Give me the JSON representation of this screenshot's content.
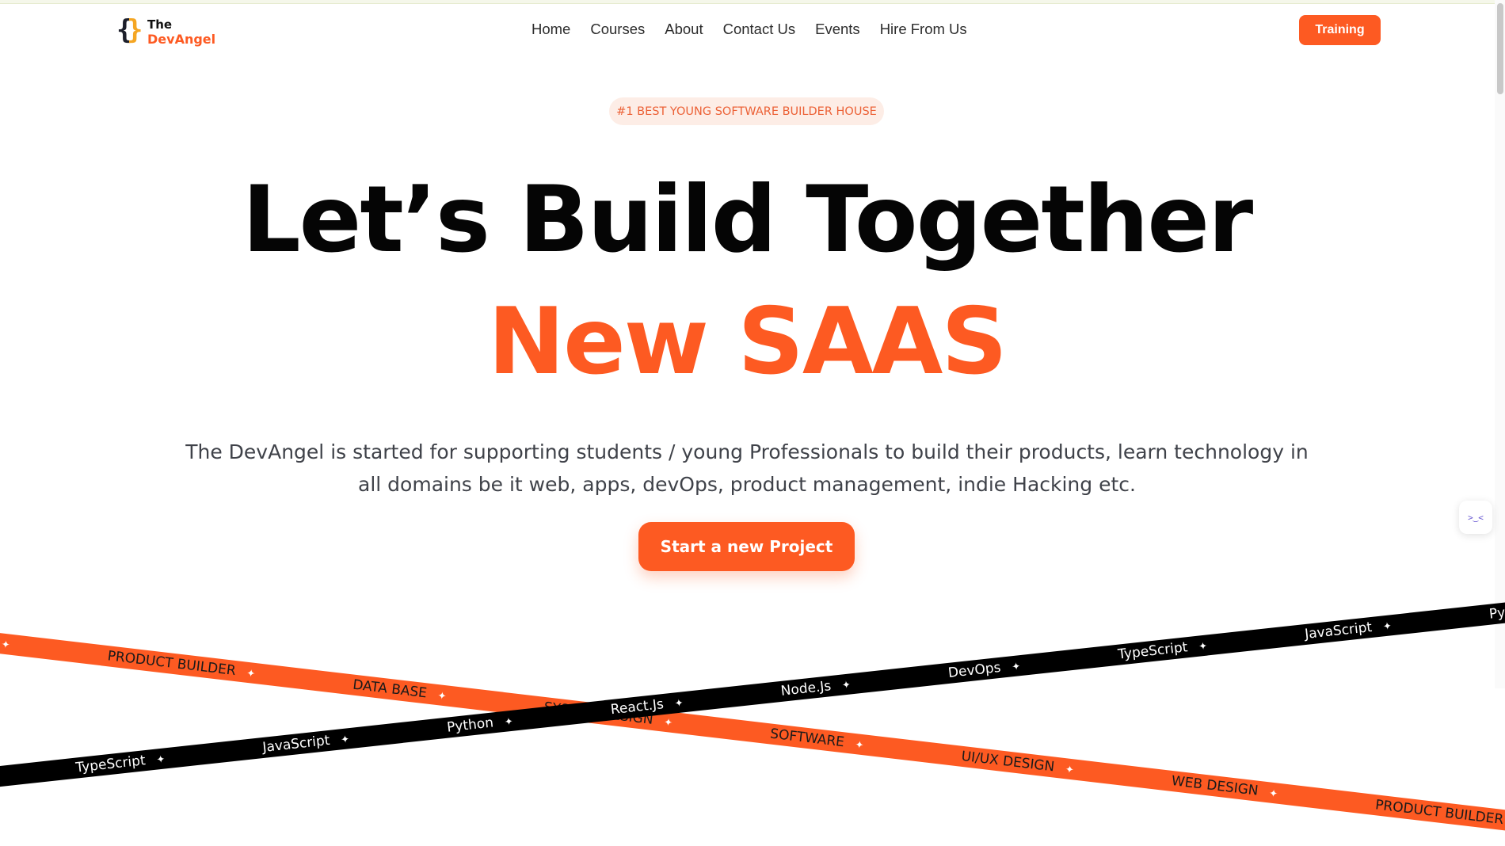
{
  "logo": {
    "line1": "The",
    "line2": "DevAngel"
  },
  "nav": [
    "Home",
    "Courses",
    "About",
    "Contact Us",
    "Events",
    "Hire From Us"
  ],
  "training_label": "Training",
  "badge": "#1 BEST YOUNG SOFTWARE BUILDER HOUSE",
  "hero": {
    "line1": "Let’s Build Together",
    "line2": "New SAAS",
    "description": "The DevAngel is started for supporting students / young Professionals to build their products, learn technology in all domains be it web, apps, devOps, product management, indie Hacking etc.",
    "cta": "Start a new Project"
  },
  "ribbon_orange": [
    "WEB DESIGN",
    "PRODUCT BUILDER",
    "DATA BASE",
    "SYSTEM DESIGN",
    "SOFTWARE",
    "UI/UX DESIGN",
    "WEB DESIGN",
    "PRODUCT BUILDER",
    "DATA BASE",
    "SYSTEM DESIGN"
  ],
  "ribbon_black": [
    "DevOps",
    "TypeScript",
    "JavaScript",
    "Python",
    "React.Js",
    "Node.Js",
    "DevOps",
    "TypeScript",
    "JavaScript",
    "Python",
    "React.Js",
    "Node.Js",
    "DevOps",
    "TypeScript"
  ],
  "star_glyph": "✦",
  "widget_glyph": ">‿<",
  "colors": {
    "accent": "#fd5a22",
    "badge_bg": "#fdede6",
    "text_dark": "#050505",
    "text_body": "#3f4249"
  }
}
